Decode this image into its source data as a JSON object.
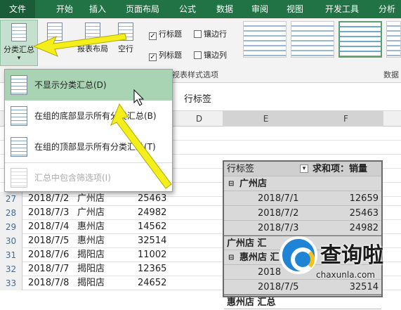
{
  "tabs": [
    "文件",
    "开始",
    "插入",
    "页面布局",
    "公式",
    "数据",
    "审阅",
    "视图",
    "开发工具",
    "分析"
  ],
  "ribbon": {
    "subtotal": "分类汇总",
    "blank": "空行",
    "report_layout": "报表布局",
    "row_headers": "行标题",
    "banded_rows": "镶边行",
    "col_headers": "列标题",
    "banded_cols": "镶边列",
    "style_options": "透视表样式选项",
    "data_label": "数据"
  },
  "menu": {
    "items": [
      {
        "label": "不显示分类汇总(D)"
      },
      {
        "label": "在组的底部显示所有分类汇总(B)"
      },
      {
        "label": "在组的顶部显示所有分类汇总(T)"
      },
      {
        "label": "汇总中包含筛选项(I)"
      }
    ]
  },
  "formula_text": "行标签",
  "columns": [
    "D",
    "E",
    "F"
  ],
  "rows": [
    {
      "num": "27",
      "date": "2018/7/2",
      "store": "广州店",
      "value": "25463"
    },
    {
      "num": "28",
      "date": "2018/7/3",
      "store": "广州店",
      "value": "24982"
    },
    {
      "num": "29",
      "date": "2018/7/4",
      "store": "惠州店",
      "value": "14562"
    },
    {
      "num": "30",
      "date": "2018/7/5",
      "store": "惠州店",
      "value": "32514"
    },
    {
      "num": "31",
      "date": "2018/7/6",
      "store": "揭阳店",
      "value": "11002"
    },
    {
      "num": "32",
      "date": "2018/7/7",
      "store": "揭阳店",
      "value": "12365"
    },
    {
      "num": "33",
      "date": "2018/7/8",
      "store": "揭阳店",
      "value": "24652"
    }
  ],
  "pivot": {
    "header_label": "行标签",
    "header_value": "求和项：销量",
    "group1": "广州店",
    "rows1": [
      {
        "date": "2018/7/1",
        "value": "12659"
      },
      {
        "date": "2018/7/2",
        "value": "25463"
      },
      {
        "date": "2018/7/3",
        "value": "24982"
      }
    ],
    "subtotal1": "广州店 汇",
    "group2": "惠州店 汇",
    "rows2": [
      {
        "date": "2018",
        "value": ""
      },
      {
        "date": "2018/7/5",
        "value": "32514"
      }
    ],
    "subtotal2": "惠州店 汇总"
  },
  "watermark": {
    "title": "查询啦",
    "url": "chaxunla.com"
  }
}
